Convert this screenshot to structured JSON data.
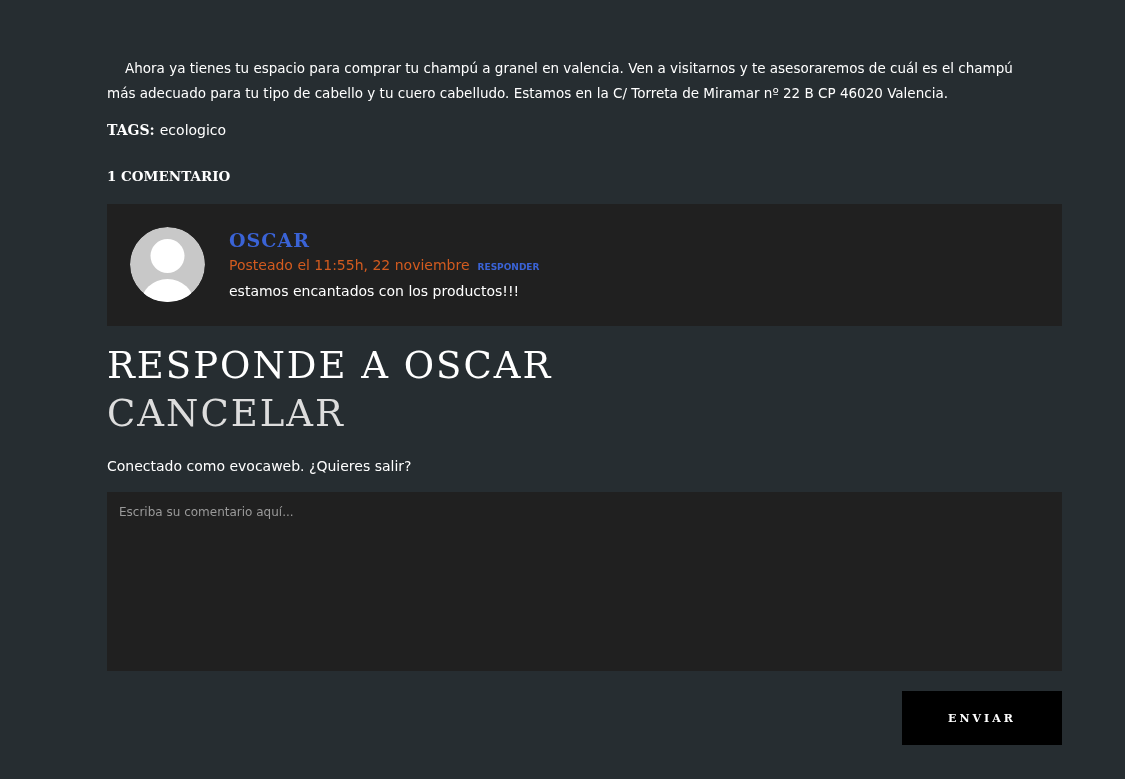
{
  "article": {
    "paragraph": "Ahora ya tienes tu espacio para comprar tu champú a granel en valencia. Ven a visitarnos y te asesoraremos de cuál es el champú más adecuado para tu tipo de cabello y tu cuero cabelludo. Estamos en la C/ Torreta de Miramar nº 22 B CP 46020 Valencia.",
    "tags_label": "TAGS:",
    "tags": [
      "ecologico"
    ]
  },
  "comments": {
    "heading": "1 COMENTARIO",
    "items": [
      {
        "author": "OSCAR",
        "posted": "Posteado el 11:55h, 22 noviembre",
        "reply": "RESPONDER",
        "text": "estamos encantados con los productos!!!"
      }
    ]
  },
  "reply_form": {
    "title": "RESPONDE A OSCAR",
    "cancel": "CANCELAR",
    "logged_in": "Conectado como evocaweb. ¿Quieres salir?",
    "placeholder": "Escriba su comentario aquí...",
    "submit": "ENVIAR"
  }
}
